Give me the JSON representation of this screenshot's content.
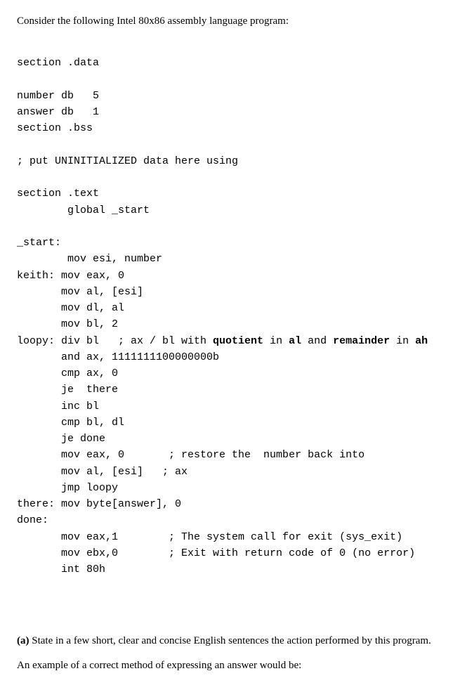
{
  "intro": "Consider the following Intel  80x86 assembly language program:",
  "code": {
    "l01": "section .data",
    "l02": "",
    "l03": "number db   5",
    "l04": "answer db   1",
    "l05": "section .bss",
    "l06": "",
    "l07": "; put UNINITIALIZED data here using",
    "l08": "",
    "l09": "section .text",
    "l10": "        global _start",
    "l11": "",
    "l12": "_start:",
    "l13": "        mov esi, number",
    "l14": "keith: mov eax, 0",
    "l15": "       mov al, [esi]",
    "l16": "       mov dl, al",
    "l17": "       mov bl, 2",
    "l18a": "loopy: div bl   ; ax / bl with ",
    "l18b": "quotient",
    "l18c": " in ",
    "l18d": "al",
    "l18e": " and ",
    "l18f": "remainder",
    "l18g": " in ",
    "l18h": "ah",
    "l19": "       and ax, 1111111100000000b",
    "l20": "       cmp ax, 0",
    "l21": "       je  there",
    "l22": "       inc bl",
    "l23": "       cmp bl, dl",
    "l24": "       je done",
    "l25": "       mov eax, 0       ; restore the  number back into",
    "l26": "       mov al, [esi]   ; ax",
    "l27": "       jmp loopy",
    "l28": "there: mov byte[answer], 0",
    "l29": "done:",
    "l30": "       mov eax,1        ; The system call for exit (sys_exit)",
    "l31": "       mov ebx,0        ; Exit with return code of 0 (no error)",
    "l32": "       int 80h"
  },
  "qa_bold": "(a)",
  "qa_rest": " State in a few short, clear and concise English sentences the action performed by this program.",
  "example_line": "An example of a correct method of expressing an answer would be:"
}
